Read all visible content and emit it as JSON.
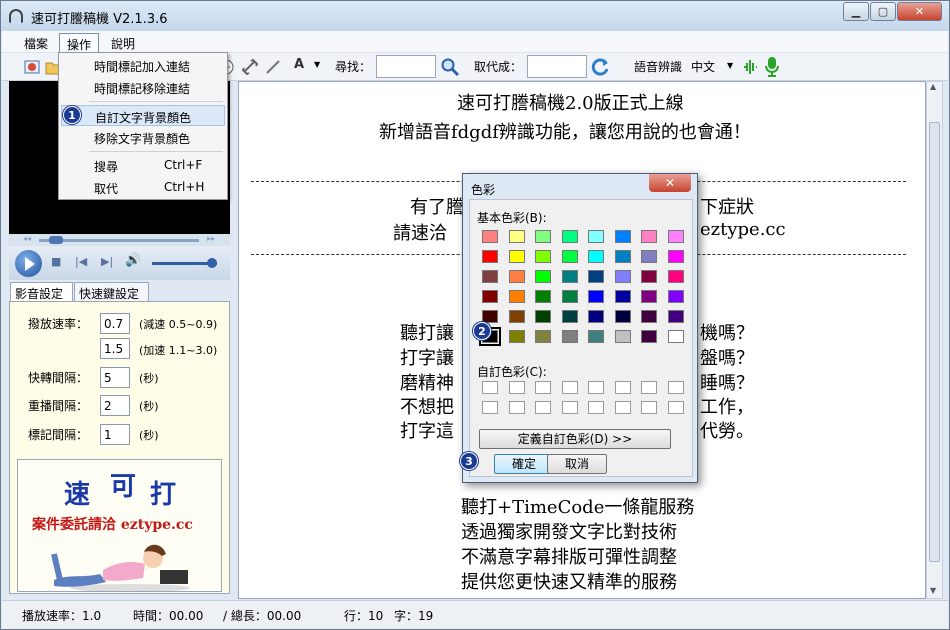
{
  "window": {
    "title": "速可打謄稿機 V2.1.3.6",
    "min": "▁",
    "max": "▢",
    "close": "✕"
  },
  "menu": {
    "file": "檔案",
    "operate": "操作",
    "help": "說明"
  },
  "toolbar": {
    "find_label": "尋找：",
    "replace_label": "取代成：",
    "speech_label": "語音辨識",
    "language": "中文",
    "find_value": "",
    "replace_value": ""
  },
  "dropdown": {
    "items": [
      {
        "label": "時間標記加入連結",
        "shortcut": ""
      },
      {
        "label": "時間標記移除連結",
        "shortcut": ""
      },
      {
        "label": "自訂文字背景顏色",
        "shortcut": ""
      },
      {
        "label": "移除文字背景顏色",
        "shortcut": ""
      },
      {
        "label": "搜尋",
        "shortcut": "Ctrl+F"
      },
      {
        "label": "取代",
        "shortcut": "Ctrl+H"
      }
    ]
  },
  "badges": {
    "b1": "1",
    "b2": "2",
    "b3": "3"
  },
  "left_tabs": {
    "av": "影音設定",
    "hotkey": "快速鍵設定"
  },
  "settings": {
    "speed_label": "撥放速率：",
    "speed_slow": "0.7",
    "speed_slow_hint": "(減速 0.5~0.9)",
    "speed_fast": "1.5",
    "speed_fast_hint": "(加速 1.1~3.0)",
    "ff_label": "快轉間隔：",
    "ff_value": "5",
    "ff_unit": "(秒)",
    "replay_label": "重播間隔：",
    "replay_value": "2",
    "replay_unit": "(秒)",
    "mark_label": "標記間隔：",
    "mark_value": "1",
    "mark_unit": "(秒)"
  },
  "ad": {
    "c1": "速",
    "c2": "可",
    "c3": "打",
    "line": "案件委託請洽 eztype.cc"
  },
  "document": {
    "line1": "速可打謄稿機2.0版正式上線",
    "line2": "新增語音fdgdf辨識功能，讓您用說的也會通！",
    "line3a": "有了謄",
    "line3b": "下症狀",
    "line4a": "請速洽",
    "line4b": "eztype.cc",
    "q1a": "聽打讓",
    "q1b": "機嗎？",
    "q2a": "打字讓",
    "q2b": "盤嗎？",
    "q3a": "磨精神",
    "q3b": "睡嗎？",
    "q4a": "不想把",
    "q4b": "工作，",
    "q5a": "打字這",
    "q5b": "代勞。",
    "p1": "聽打+TimeCode一條龍服務",
    "p2": "透過獨家開發文字比對技術",
    "p3": "不滿意字幕排版可彈性調整",
    "p4": "提供您更快速又精準的服務"
  },
  "status": {
    "speed": "播放速率：1.0",
    "time": "時間：00.00",
    "length": "/ 總長：00.00",
    "row": "行：10",
    "chars": "字：19"
  },
  "color_dialog": {
    "title": "色彩",
    "basic_label": "基本色彩(B):",
    "custom_label": "自訂色彩(C):",
    "define_button": "定義自訂色彩(D) >>",
    "ok": "確定",
    "cancel": "取消",
    "basic_colors": [
      "#ff8080",
      "#ffff80",
      "#80ff80",
      "#00ff80",
      "#80ffff",
      "#0080ff",
      "#ff80c0",
      "#ff80ff",
      "#ff0000",
      "#ffff00",
      "#80ff00",
      "#00ff40",
      "#00ffff",
      "#0080c0",
      "#8080c0",
      "#ff00ff",
      "#804040",
      "#ff8040",
      "#00ff00",
      "#008080",
      "#004080",
      "#8080ff",
      "#800040",
      "#ff0080",
      "#800000",
      "#ff8000",
      "#008000",
      "#008040",
      "#0000ff",
      "#0000a0",
      "#800080",
      "#8000ff",
      "#400000",
      "#804000",
      "#004000",
      "#004040",
      "#000080",
      "#000040",
      "#400040",
      "#400080",
      "#000000",
      "#808000",
      "#808040",
      "#808080",
      "#408080",
      "#c0c0c0",
      "#400040",
      "#ffffff"
    ],
    "selected_index": 40
  }
}
